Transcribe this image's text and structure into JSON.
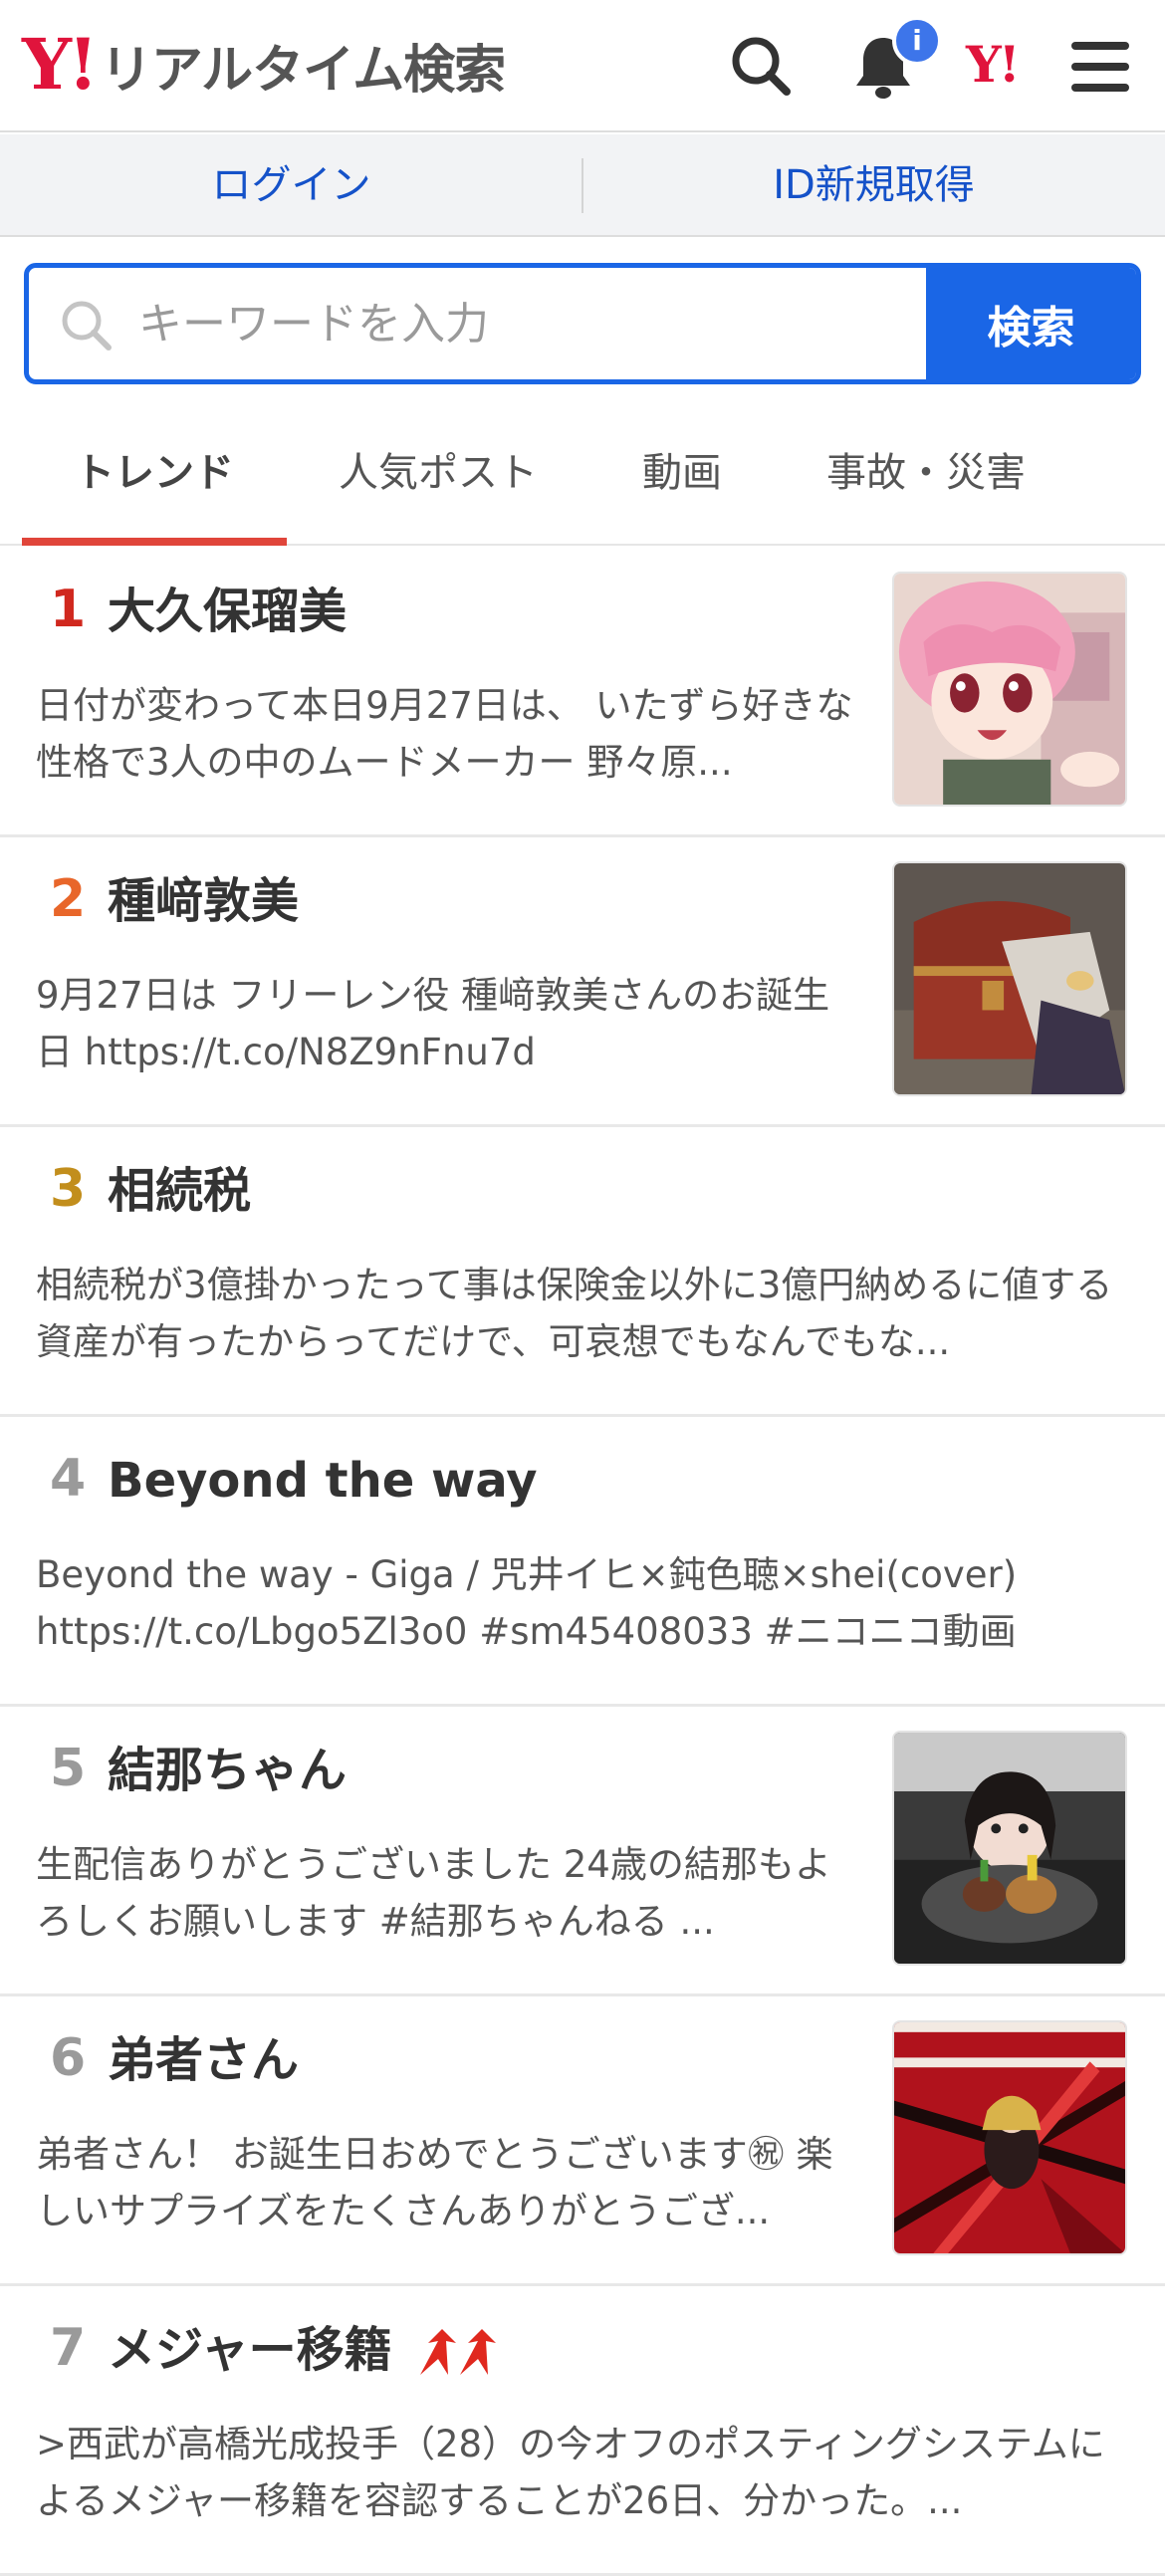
{
  "header": {
    "logo_y": "Y!",
    "logo_text": "リアルタイム検索",
    "notification_badge": "i",
    "yahoo_mark": "Y!"
  },
  "login_bar": {
    "login": "ログイン",
    "register": "ID新規取得"
  },
  "search": {
    "placeholder": "キーワードを入力",
    "button": "検索"
  },
  "tabs": [
    {
      "label": "トレンド",
      "active": true
    },
    {
      "label": "人気ポスト"
    },
    {
      "label": "動画"
    },
    {
      "label": "事故・災害"
    }
  ],
  "trends": [
    {
      "rank": "1",
      "rank_color": "#d0281e",
      "title": "大久保瑠美",
      "desc": "日付が変わって本日9月27日は、 いたずら好きな性格で3人の中のムードメーカー 野々原...",
      "thumb": "anime-girl"
    },
    {
      "rank": "2",
      "rank_color": "#e8662a",
      "title": "種﨑敦美",
      "desc": "9月27日は フリーレン役 種﨑敦美さんのお誕生日 https://t.co/N8Z9nFnu7d",
      "thumb": "treasure-chest"
    },
    {
      "rank": "3",
      "rank_color": "#c28e1c",
      "title": "相続税",
      "desc": "相続税が3億掛かったって事は保険金以外に3億円納めるに値する資産が有ったからってだけで、可哀想でもなんでもな...",
      "thumb": ""
    },
    {
      "rank": "4",
      "rank_color": "#9a9a9a",
      "title": "Beyond the way",
      "desc": "Beyond the way - Giga / 咒井イヒ×鈍色聴×shei(cover) https://t.co/Lbgo5Zl3o0 #sm45408033 #ニコニコ動画",
      "thumb": ""
    },
    {
      "rank": "5",
      "rank_color": "#9a9a9a",
      "title": "結那ちゃん",
      "desc": "生配信ありがとうございました  24歳の結那もよろしくお願いします #結那ちゃんねる ...",
      "thumb": "birthday-photo"
    },
    {
      "rank": "6",
      "rank_color": "#9a9a9a",
      "title": "弟者さん",
      "desc": "弟者さん！ お誕生日おめでとうございます㊗ 楽しいサプライズをたくさんありがとうござ...",
      "thumb": "red-illustration"
    },
    {
      "rank": "7",
      "rank_color": "#9a9a9a",
      "title": "メジャー移籍",
      "desc": ">西武が高橋光成投手（28）の今オフのポスティングシステムによるメジャー移籍を容認することが26日、分かった。...",
      "thumb": "",
      "rising": true
    }
  ],
  "colors": {
    "brand_red": "#e0143c",
    "accent_blue": "#1a66e6",
    "link_blue": "#1552c9",
    "tab_underline": "#e0453a",
    "rising_arrow": "#e0281e"
  }
}
